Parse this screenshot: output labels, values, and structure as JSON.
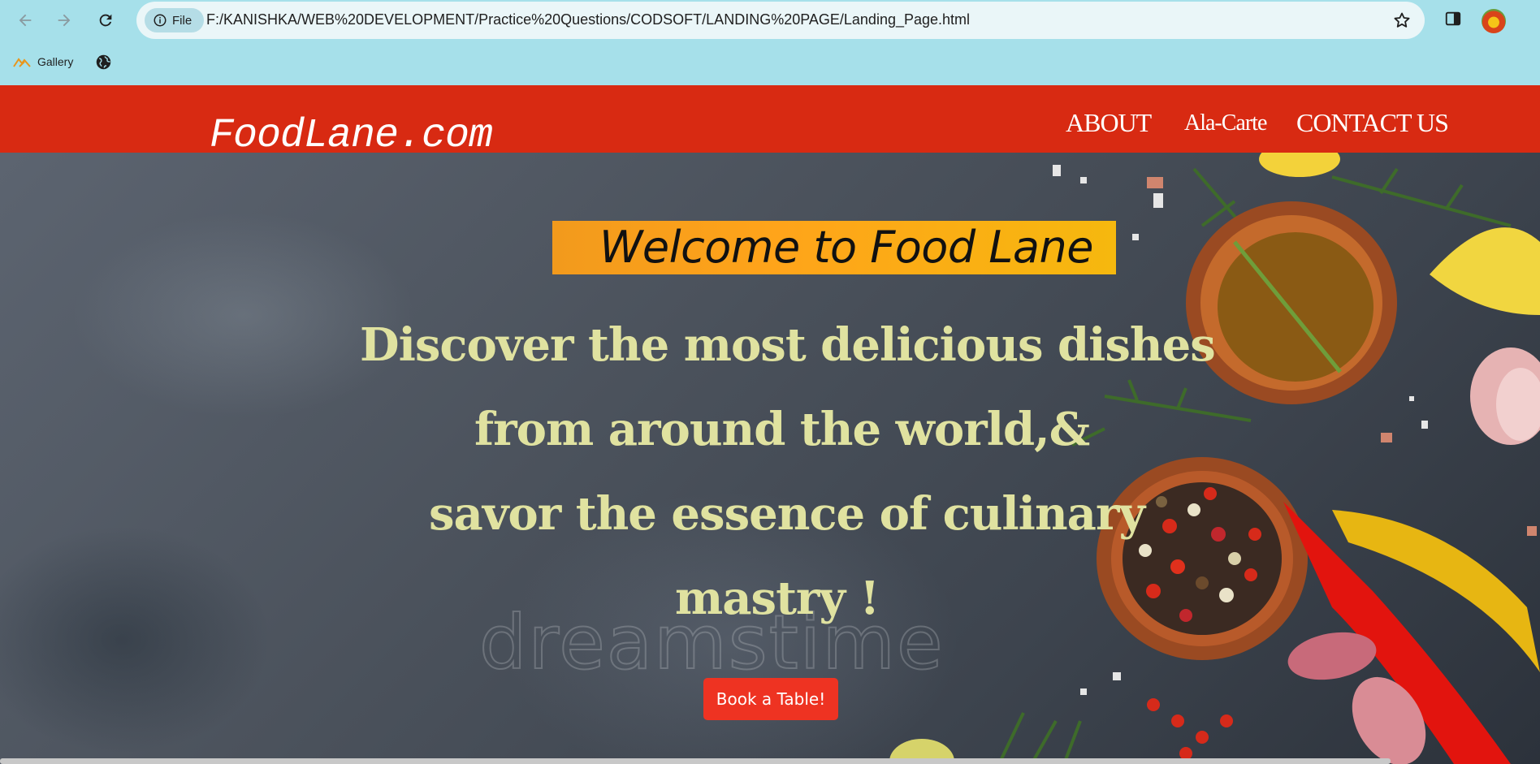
{
  "browser": {
    "site_chip_label": "File",
    "url": "F:/KANISHKA/WEB%20DEVELOPMENT/Practice%20Questions/CODSOFT/LANDING%20PAGE/Landing_Page.html",
    "bookmarks": [
      {
        "label": "Gallery",
        "icon": "gallery-icon"
      },
      {
        "label": "",
        "icon": "globe-icon"
      }
    ],
    "colors": {
      "chrome_bg": "#a6e0ea",
      "omnibox_bg": "#eaf6f8"
    }
  },
  "site": {
    "brand": "FoodLane.com",
    "nav": {
      "about": "ABOUT",
      "alacarte": "Ala-Carte",
      "contact": "CONTACT US"
    },
    "colors": {
      "header_bg": "#d82a12",
      "accent": "#ee3322",
      "tagline": "#e0e2a0",
      "welcome_banner": "#ffa41a"
    }
  },
  "hero": {
    "welcome": "Welcome to Food Lane",
    "tagline_lines": [
      "Discover the most delicious dishes",
      "from around the world,&",
      "savor the essence of  culinary",
      "mastry !"
    ],
    "watermark": "dreamstime",
    "cta": "Book a Table!"
  }
}
